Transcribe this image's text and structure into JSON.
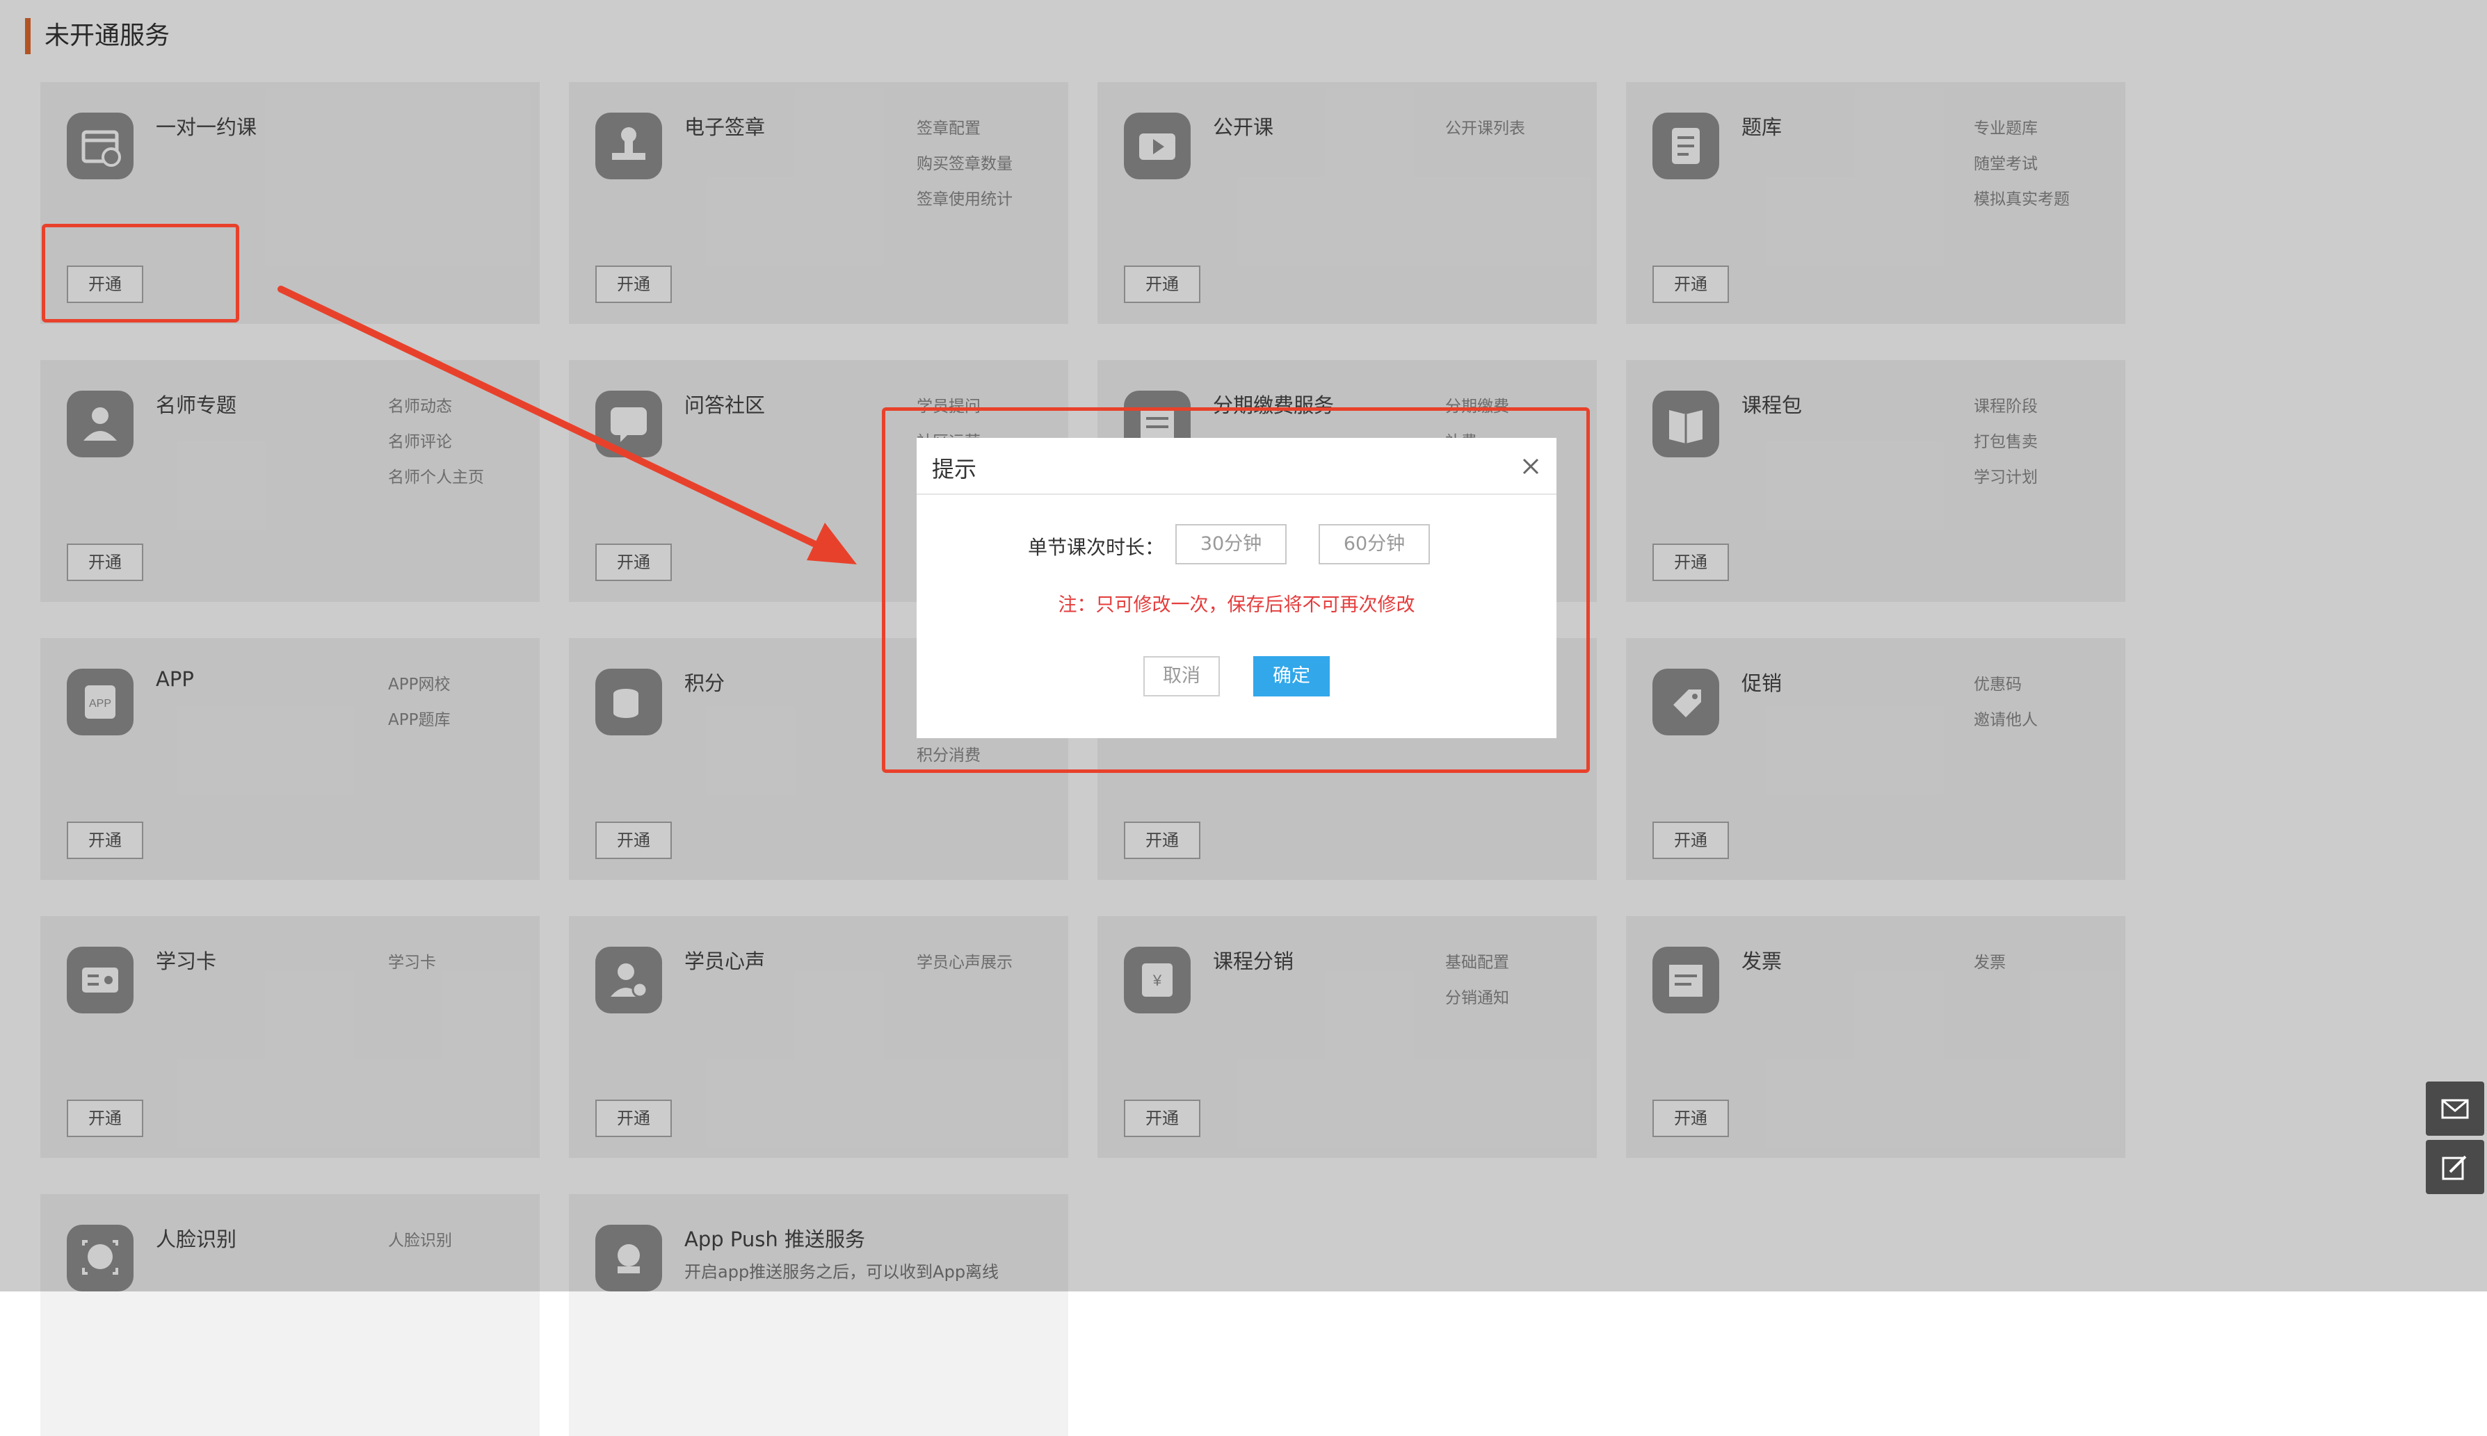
{
  "section_title": "未开通服务",
  "open_label": "开通",
  "cards": [
    {
      "name": "一对一约课",
      "icon": "calendar-clock-icon",
      "links": []
    },
    {
      "name": "电子签章",
      "icon": "stamp-icon",
      "links": [
        "签章配置",
        "购买签章数量",
        "签章使用统计"
      ]
    },
    {
      "name": "公开课",
      "icon": "video-play-icon",
      "links": [
        "公开课列表"
      ]
    },
    {
      "name": "题库",
      "icon": "question-bank-icon",
      "links": [
        "专业题库",
        "随堂考试",
        "模拟真实考题"
      ]
    },
    {
      "name": "名师专题",
      "icon": "teacher-icon",
      "links": [
        "名师动态",
        "名师评论",
        "名师个人主页"
      ]
    },
    {
      "name": "问答社区",
      "icon": "qa-chat-icon",
      "links": [
        "学员提问",
        "社区运营"
      ]
    },
    {
      "name": "分期缴费服务",
      "icon": "installment-icon",
      "links": [
        "分期缴费",
        "补费"
      ]
    },
    {
      "name": "课程包",
      "icon": "course-package-icon",
      "links": [
        "课程阶段",
        "打包售卖",
        "学习计划"
      ]
    },
    {
      "name": "APP",
      "icon": "app-icon",
      "links": [
        "APP网校",
        "APP题库"
      ]
    },
    {
      "name": "积分",
      "icon": "points-coins-icon",
      "links": [
        "",
        "",
        "积分消费"
      ]
    },
    {
      "name": "",
      "icon": "",
      "links": []
    },
    {
      "name": "促销",
      "icon": "promotion-tag-icon",
      "links": [
        "优惠码",
        "邀请他人"
      ]
    },
    {
      "name": "学习卡",
      "icon": "study-card-icon",
      "links": [
        "学习卡"
      ]
    },
    {
      "name": "学员心声",
      "icon": "student-voice-icon",
      "links": [
        "学员心声展示"
      ]
    },
    {
      "name": "课程分销",
      "icon": "distribution-icon",
      "links": [
        "基础配置",
        "分销通知"
      ]
    },
    {
      "name": "发票",
      "icon": "invoice-icon",
      "links": [
        "发票"
      ]
    },
    {
      "name": "人脸识别",
      "icon": "face-recognition-icon",
      "links": [
        "人脸识别"
      ]
    },
    {
      "name": "App Push 推送服务",
      "icon": "push-service-icon",
      "links": [],
      "desc": "开启app推送服务之后，可以收到App离线"
    }
  ],
  "modal": {
    "title": "提示",
    "field_label": "单节课次时长：",
    "options": [
      "30分钟",
      "60分钟"
    ],
    "note": "注：只可修改一次，保存后将不可再次修改",
    "cancel": "取消",
    "confirm": "确定"
  },
  "colors": {
    "accent": "#e0682e",
    "annotation_red": "#e8412b",
    "confirm_blue": "#32a7ea",
    "note_red": "#e43c3c"
  },
  "side_tools": [
    "mail-icon",
    "edit-icon"
  ]
}
